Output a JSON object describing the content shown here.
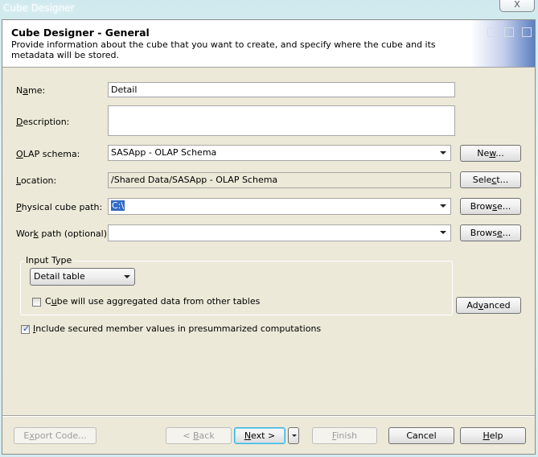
{
  "window": {
    "title": "Cube Designer",
    "close_label": "X"
  },
  "header": {
    "title": "Cube Designer - General",
    "description": "Provide information about the cube that you want to create, and specify where the cube and its metadata will be stored."
  },
  "form": {
    "name": {
      "label_pre": "N",
      "label_u": "a",
      "label_post": "me:",
      "value": "Detail"
    },
    "description": {
      "label_pre": "",
      "label_u": "D",
      "label_post": "escription:",
      "value": ""
    },
    "olap_schema": {
      "label_pre": "",
      "label_u": "O",
      "label_post": "LAP schema:",
      "value": "SASApp - OLAP Schema",
      "button_pre": "Ne",
      "button_u": "w",
      "button_post": "..."
    },
    "location": {
      "label_pre": "",
      "label_u": "L",
      "label_post": "ocation:",
      "value": "/Shared Data/SASApp - OLAP Schema",
      "button_pre": "Sele",
      "button_u": "c",
      "button_post": "t..."
    },
    "physical_cube_path": {
      "label_pre": "",
      "label_u": "P",
      "label_post": "hysical cube path:",
      "value": "C:\\",
      "button_pre": "Brow",
      "button_u": "s",
      "button_post": "e..."
    },
    "work_path": {
      "label_pre": "Wor",
      "label_u": "k",
      "label_post": " path (optional):",
      "value": "",
      "button_pre": "Brows",
      "button_u": "e",
      "button_post": "..."
    }
  },
  "input_type": {
    "legend": "Input Type",
    "selected": "Detail table",
    "aggregated_checkbox": {
      "label_pre": "C",
      "label_u": "u",
      "label_post": "be will use aggregated data from other tables",
      "checked": false
    },
    "advanced_button": {
      "pre": "Ad",
      "u": "v",
      "post": "anced"
    }
  },
  "secured_checkbox": {
    "label_pre": "",
    "label_u": "I",
    "label_post": "nclude secured member values in presummarized computations",
    "checked": true,
    "mark": "✓"
  },
  "footer": {
    "export_code": {
      "pre": "E",
      "u": "x",
      "post": "port Code..."
    },
    "back": {
      "pre": "< ",
      "u": "B",
      "post": "ack"
    },
    "next": {
      "pre": "",
      "u": "N",
      "post": "ext >"
    },
    "finish": {
      "pre": "",
      "u": "F",
      "post": "inish"
    },
    "cancel": {
      "pre": "Cancel",
      "u": "",
      "post": ""
    },
    "help": {
      "pre": "",
      "u": "H",
      "post": "elp"
    }
  }
}
